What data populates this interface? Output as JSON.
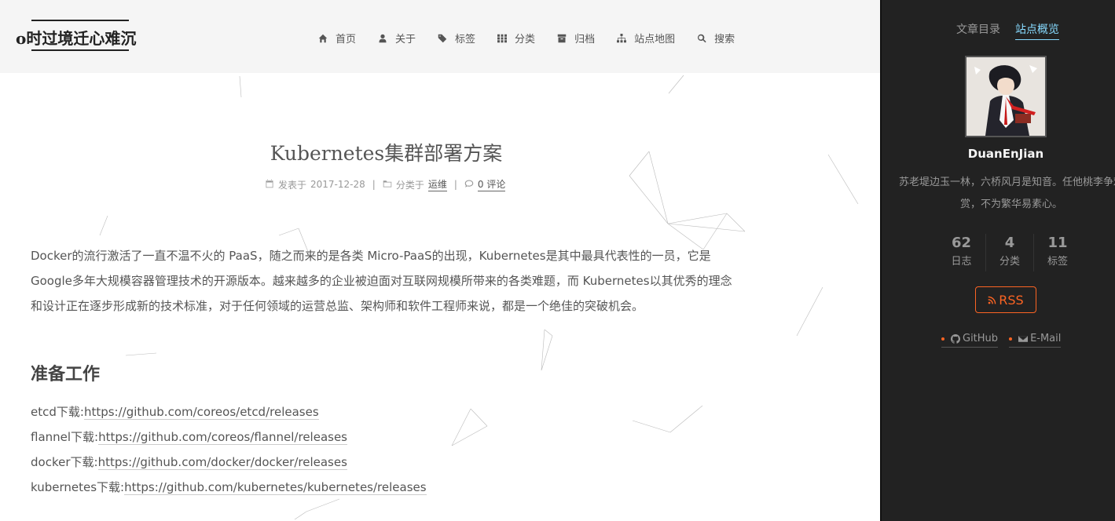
{
  "brand": {
    "title": "o时过境迁心难沉"
  },
  "nav": [
    {
      "label": "首页",
      "icon": "home-icon"
    },
    {
      "label": "关于",
      "icon": "user-icon"
    },
    {
      "label": "标签",
      "icon": "tags-icon"
    },
    {
      "label": "分类",
      "icon": "th-icon"
    },
    {
      "label": "归档",
      "icon": "archive-icon"
    },
    {
      "label": "站点地图",
      "icon": "sitemap-icon"
    },
    {
      "label": "搜索",
      "icon": "search-icon"
    }
  ],
  "post": {
    "title": "Kubernetes集群部署方案",
    "meta": {
      "posted_label": "发表于",
      "date": "2017-12-28",
      "category_label": "分类于",
      "category": "运维",
      "comments": "0 评论"
    },
    "intro": "Docker的流行激活了一直不温不火的 PaaS，随之而来的是各类 Micro-PaaS的出现，Kubernetes是其中最具代表性的一员，它是 Google多年大规模容器管理技术的开源版本。越来越多的企业被迫面对互联网规模所带来的各类难题，而 Kubernetes以其优秀的理念和设计正在逐步形成新的技术标准，对于任何领域的运营总监、架构师和软件工程师来说，都是一个绝佳的突破机会。",
    "section_heading": "准备工作",
    "downloads": [
      {
        "label": "etcd下载:",
        "url": "https://github.com/coreos/etcd/releases"
      },
      {
        "label": "flannel下载:",
        "url": "https://github.com/coreos/flannel/releases"
      },
      {
        "label": "docker下载:",
        "url": "https://github.com/docker/docker/releases"
      },
      {
        "label": "kubernetes下载:",
        "url": "https://github.com/kubernetes/kubernetes/releases"
      }
    ]
  },
  "sidebar": {
    "tabs": [
      {
        "label": "文章目录",
        "active": false
      },
      {
        "label": "站点概览",
        "active": true
      }
    ],
    "author": "DuanEnJian",
    "description": "苏老堤边玉一林，六桥风月是知音。任他桃李争欢赏，不为繁华易素心。",
    "stats": [
      {
        "num": "62",
        "label": "日志"
      },
      {
        "num": "4",
        "label": "分类"
      },
      {
        "num": "11",
        "label": "标签"
      }
    ],
    "rss": "RSS",
    "social": [
      {
        "label": "GitHub",
        "icon": "github-icon"
      },
      {
        "label": "E-Mail",
        "icon": "envelope-icon"
      }
    ]
  },
  "colors": {
    "accent": "#87daff",
    "rss": "#fc6423",
    "sidebar_bg": "#222222",
    "header_bg": "#f5f5f5"
  }
}
